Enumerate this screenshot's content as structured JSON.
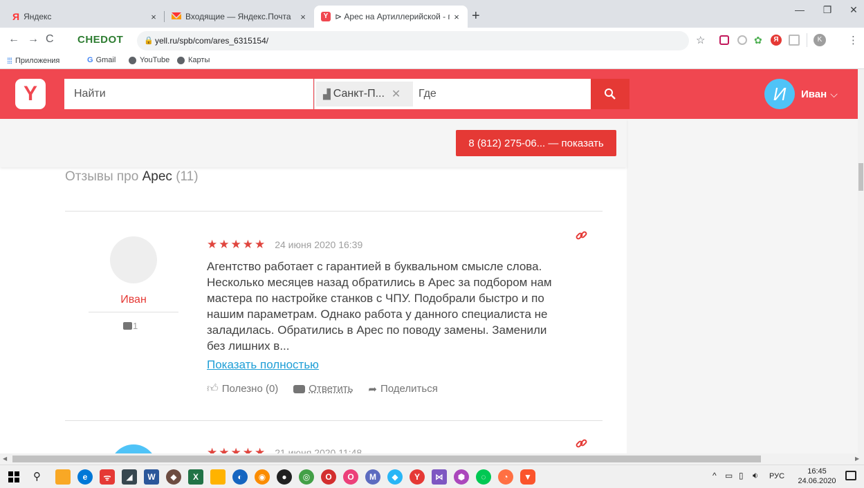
{
  "browser": {
    "tabs": [
      {
        "title": "Яндекс",
        "icon": "yandex-icon"
      },
      {
        "title": "Входящие — Яндекс.Почта",
        "icon": "mail-icon"
      },
      {
        "title": "⊳ Арес на Артиллерийской - пс",
        "icon": "yell-icon"
      }
    ],
    "new_tab": "+",
    "close": "×",
    "address": "yell.ru/spb/com/ares_6315154/",
    "brand": "CHEDOT",
    "bookmarks": [
      {
        "label": "Приложения",
        "icon": "apps-grid-icon"
      },
      {
        "label": "Gmail",
        "icon": "google-icon"
      },
      {
        "label": "YouTube",
        "icon": "globe-icon"
      },
      {
        "label": "Карты",
        "icon": "globe-icon"
      }
    ],
    "profile_letter": "K"
  },
  "site": {
    "logo": "Y",
    "search_placeholder": "Найти",
    "city": "Санкт-П...",
    "where_placeholder": "Где",
    "user_initial": "И",
    "user_name": "Иван",
    "phone_button": "8 (812) 275-06... — показать"
  },
  "reviews_header": {
    "prefix": "Отзывы про",
    "company": "Арес",
    "count": "(11)"
  },
  "reviews": [
    {
      "stars": "★★★★★",
      "date": "24 июня 2020 16:39",
      "author": "Иван",
      "author_reviews": "1",
      "lines": [
        "Агентство работает с гарантией в буквальном смысле слова.",
        "Несколько месяцев назад обратились в Арес за подбором нам",
        "мастера по настройке станков с ЧПУ. Подобрали быстро и по",
        "нашим параметрам. Однако работа у данного специалиста не",
        "заладилась. Обратились в Арес по поводу замены. Заменили",
        "без лишних в..."
      ],
      "show_full": "Показать полностью",
      "useful": "Полезно (0)",
      "reply": "Ответить",
      "share": "Поделиться"
    },
    {
      "stars": "★★★★★",
      "date": "21 июня 2020 11:48"
    }
  ],
  "taskbar": {
    "lang": "РУС",
    "time": "16:45",
    "date": "24.06.2020"
  },
  "colors": {
    "brand_red": "#f04750",
    "search_red": "#e53935",
    "link_blue": "#1e9ed6",
    "star_red": "#e0453e",
    "avatar_blue": "#4fc3f7"
  }
}
